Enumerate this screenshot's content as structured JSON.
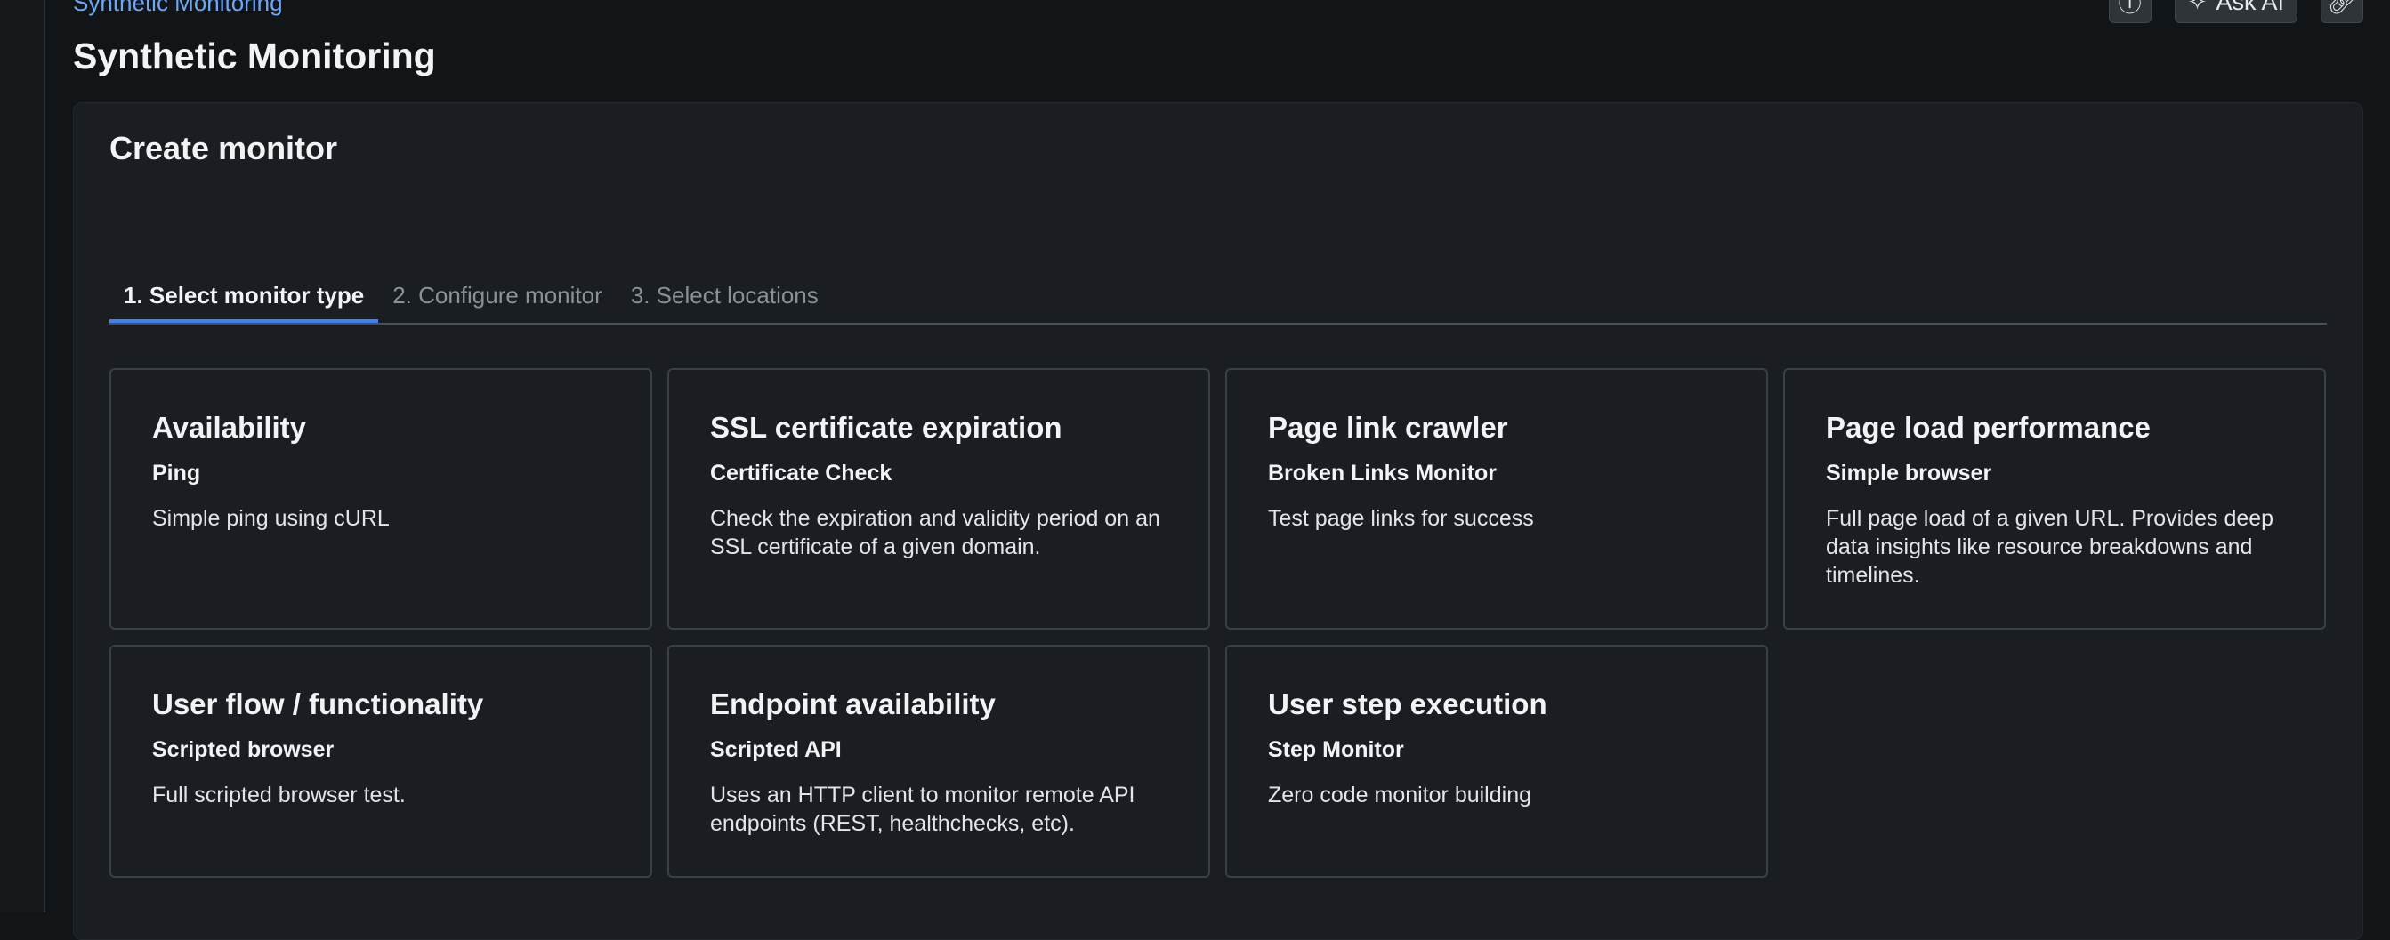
{
  "header": {
    "breadcrumb": "Synthetic Monitoring",
    "title": "Synthetic Monitoring",
    "actions": {
      "help_icon": "info-circle-icon",
      "ask_ai_label": "Ask AI",
      "ask_ai_icon": "sparkle-icon",
      "link_icon": "link-icon"
    }
  },
  "panel": {
    "title": "Create monitor",
    "steps": [
      {
        "label": "1. Select monitor type",
        "active": true
      },
      {
        "label": "2. Configure monitor",
        "active": false
      },
      {
        "label": "3. Select locations",
        "active": false
      }
    ],
    "cards": [
      {
        "title": "Availability",
        "subtitle": "Ping",
        "description": "Simple ping using cURL"
      },
      {
        "title": "SSL certificate expiration",
        "subtitle": "Certificate Check",
        "description": "Check the expiration and validity period on an SSL certificate of a given domain."
      },
      {
        "title": "Page link crawler",
        "subtitle": "Broken Links Monitor",
        "description": "Test page links for success"
      },
      {
        "title": "Page load performance",
        "subtitle": "Simple browser",
        "description": "Full page load of a given URL. Provides deep data insights like resource breakdowns and timelines."
      },
      {
        "title": "User flow / functionality",
        "subtitle": "Scripted browser",
        "description": "Full scripted browser test."
      },
      {
        "title": "Endpoint availability",
        "subtitle": "Scripted API",
        "description": "Uses an HTTP client to monitor remote API endpoints (REST, healthchecks, etc)."
      },
      {
        "title": "User step execution",
        "subtitle": "Step Monitor",
        "description": "Zero code monitor building"
      }
    ]
  },
  "colors": {
    "background": "#111518",
    "panel": "#1a1e22",
    "accent": "#3b82f6",
    "link": "#6ea7f5"
  }
}
